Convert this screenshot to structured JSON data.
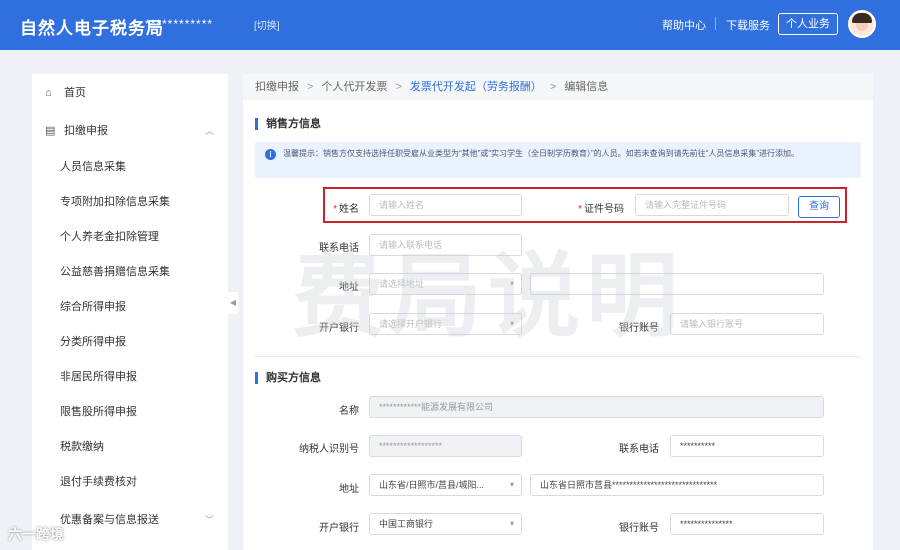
{
  "header": {
    "brand": "自然人电子税务局",
    "masked_name": "************",
    "switch_label": "[切换]",
    "help_label": "帮助中心",
    "download_label": "下载服务",
    "personal_label": "个人业务"
  },
  "sidebar": {
    "items": [
      {
        "label": "首页",
        "icon": "home-icon"
      },
      {
        "label": "扣缴申报",
        "icon": "document-icon",
        "expanded": true
      },
      {
        "label": "人员信息采集"
      },
      {
        "label": "专项附加扣除信息采集"
      },
      {
        "label": "个人养老金扣除管理"
      },
      {
        "label": "公益慈善捐赠信息采集"
      },
      {
        "label": "综合所得申报"
      },
      {
        "label": "分类所得申报"
      },
      {
        "label": "非居民所得申报"
      },
      {
        "label": "限售股所得申报"
      },
      {
        "label": "税款缴纳"
      },
      {
        "label": "退付手续费核对"
      },
      {
        "label": "优惠备案与信息报送",
        "collapsed": true
      }
    ]
  },
  "breadcrumb": [
    "扣缴申报",
    "个人代开发票",
    "发票代开发起（劳务报酬）",
    "编辑信息"
  ],
  "seller": {
    "title": "销售方信息",
    "notice": "温馨提示：销售方仅支持选择任职受雇从业类型为“其他”或“实习学生（全日制学历教育）”的人员。如若未查询到请先前往“人员信息采集”进行添加。",
    "name_label": "姓名",
    "name_placeholder": "请输入姓名",
    "id_label": "证件号码",
    "id_placeholder": "请输入完整证件号码",
    "query_label": "查询",
    "phone_label": "联系电话",
    "phone_placeholder": "请输入联系电话",
    "address_label": "地址",
    "address_placeholder": "请选择地址",
    "bank_label": "开户银行",
    "bank_placeholder": "请选择开户银行",
    "account_label": "银行账号",
    "account_placeholder": "请输入银行账号"
  },
  "buyer": {
    "title": "购买方信息",
    "name_label": "名称",
    "name_value": "************能源发展有限公司",
    "taxid_label": "纳税人识别号",
    "taxid_value": "******************",
    "phone_label": "联系电话",
    "phone_value": "**********",
    "address_label": "地址",
    "address_region": "山东省/日照市/莒县/城阳...",
    "address_detail": "山东省日照市莒县******************************",
    "bank_label": "开户银行",
    "bank_value": "中国工商银行",
    "account_label": "银行账号",
    "account_value": "***************"
  },
  "watermark": "费局说明",
  "corner_mark": "六一跨境",
  "colors": {
    "brand_blue": "#2f6fde",
    "highlight_red": "#cc2229"
  }
}
